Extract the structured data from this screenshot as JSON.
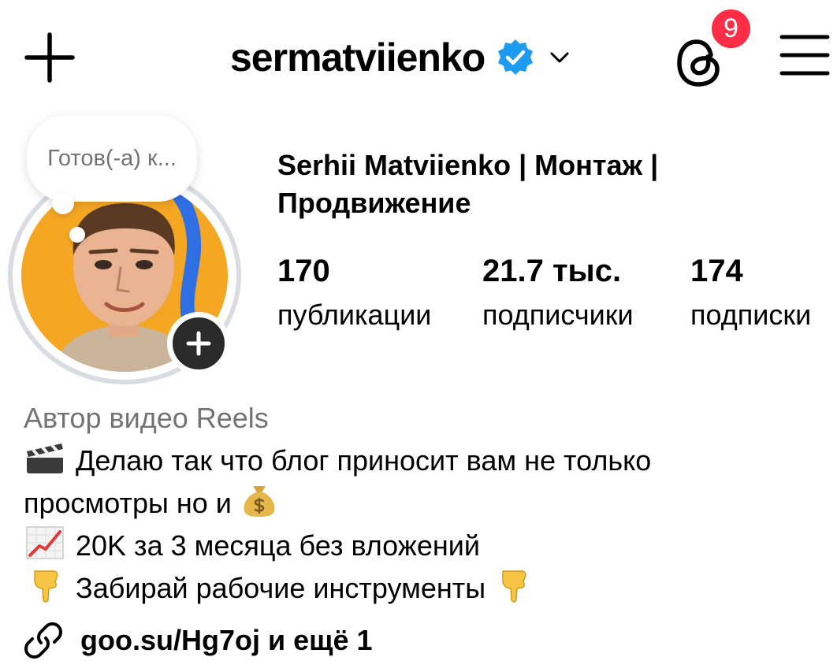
{
  "header": {
    "username": "sermatviienko",
    "notification_count": "9",
    "icons": [
      "plus-icon",
      "verified-badge-icon",
      "chevron-down-icon",
      "threads-icon",
      "menu-icon"
    ]
  },
  "note": {
    "text": "Готов(-а) к..."
  },
  "profile": {
    "full_name": "Serhii Matviienko | Монтаж | Продвижение"
  },
  "stats": [
    {
      "value": "170",
      "label": "публикации"
    },
    {
      "value": "21.7 тыс.",
      "label": "подписчики"
    },
    {
      "value": "174",
      "label": "подписки"
    }
  ],
  "bio": {
    "category": "Автор видео Reels",
    "line1": "Делаю так что блог приносит вам не только",
    "line2": "просмотры но и",
    "line3": "20K за 3 месяца без вложений",
    "line4": "Забирай рабочие инструменты",
    "emojis": [
      "clapper-board",
      "money-bag",
      "chart-increasing",
      "backhand-index-pointing-down"
    ]
  },
  "link": {
    "text": "goo.su/Hg7oj и ещё 1"
  },
  "colors": {
    "verified": "#1d9bf0",
    "badge": "#ff2d45",
    "secondary_text": "#737373",
    "avatar_bg": "#f5a623"
  }
}
